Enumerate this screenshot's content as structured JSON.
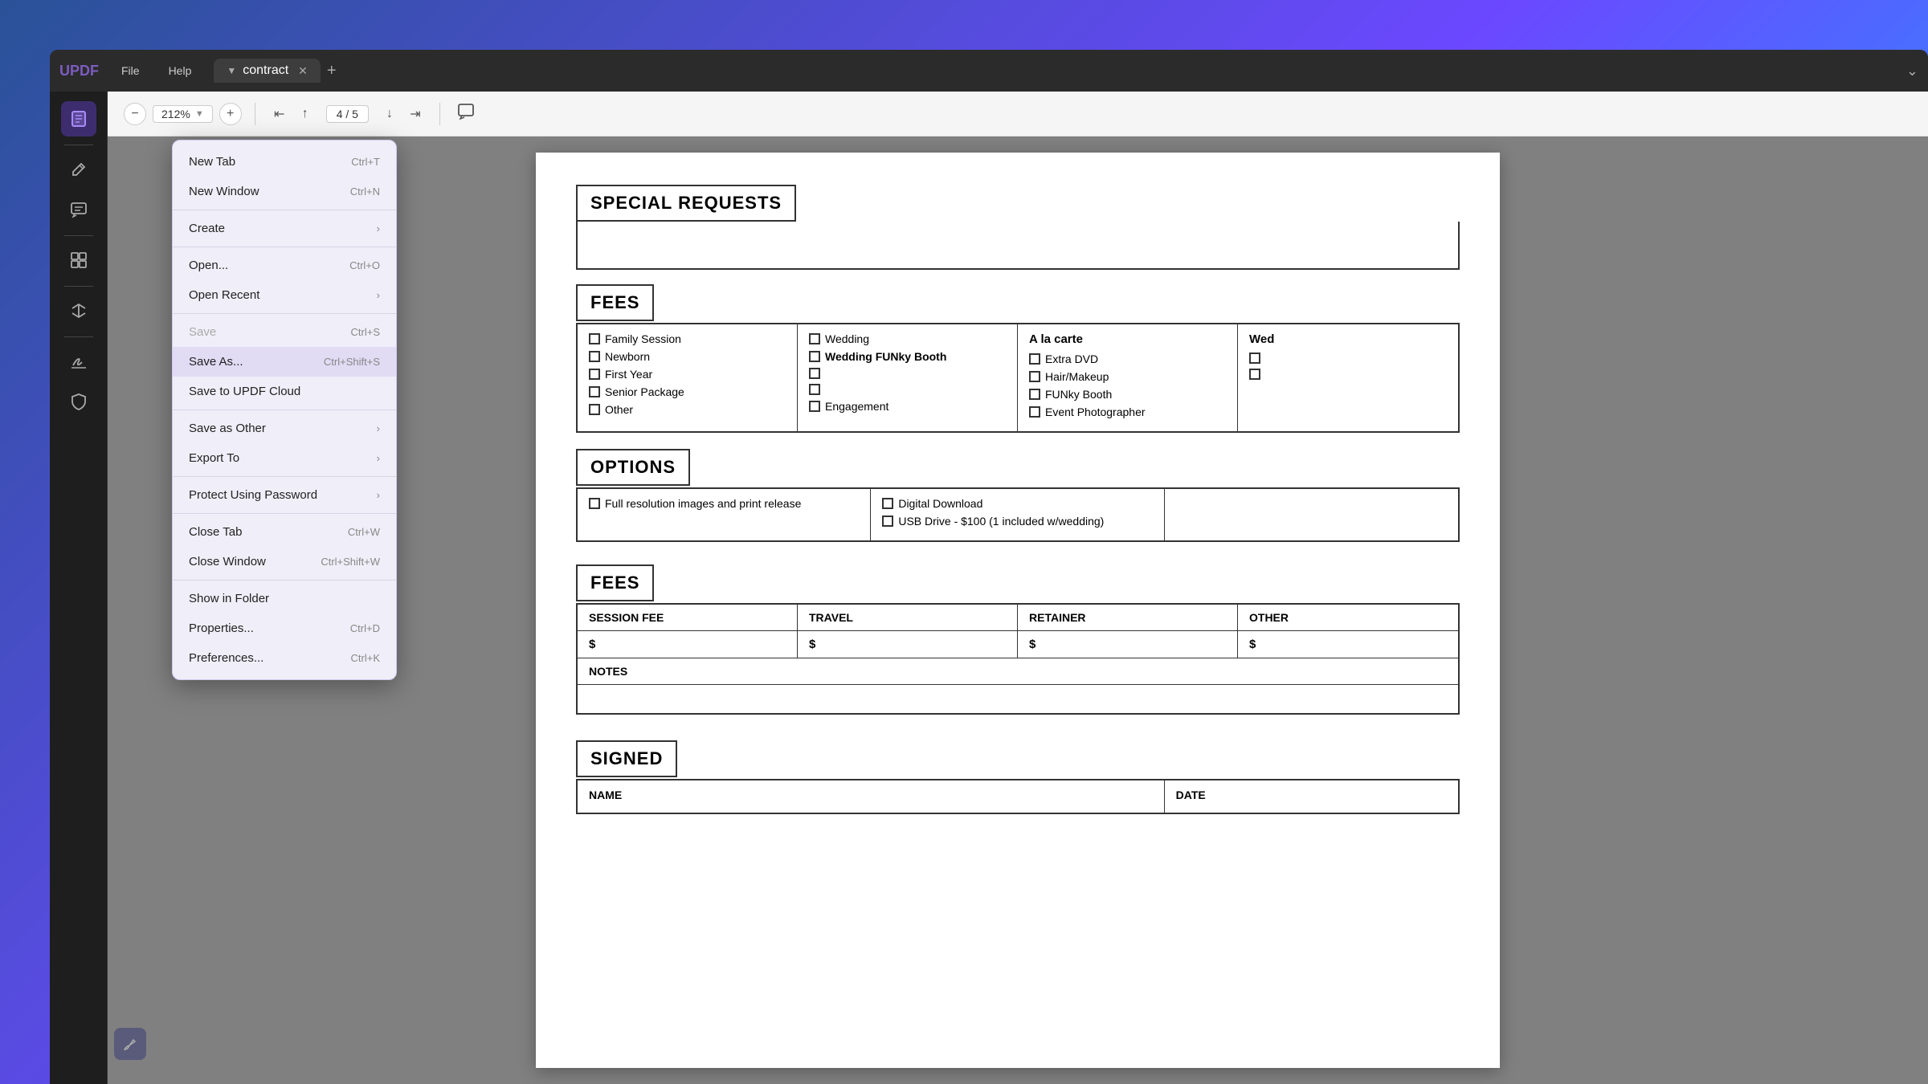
{
  "app": {
    "logo": "UPDF",
    "tab_name": "contract",
    "zoom": "212%",
    "page_current": "4",
    "page_total": "5"
  },
  "toolbar": {
    "zoom_out": "−",
    "zoom_in": "+",
    "nav_first": "⇤",
    "nav_prev": "↑",
    "nav_next": "↓",
    "nav_last": "⇥"
  },
  "menu": {
    "items": [
      {
        "id": "new-tab",
        "label": "New Tab",
        "shortcut": "Ctrl+T",
        "has_arrow": false,
        "disabled": false
      },
      {
        "id": "new-window",
        "label": "New Window",
        "shortcut": "Ctrl+N",
        "has_arrow": false,
        "disabled": false
      },
      {
        "id": "divider1",
        "type": "divider"
      },
      {
        "id": "create",
        "label": "Create",
        "shortcut": "",
        "has_arrow": true,
        "disabled": false
      },
      {
        "id": "divider2",
        "type": "divider"
      },
      {
        "id": "open",
        "label": "Open...",
        "shortcut": "Ctrl+O",
        "has_arrow": false,
        "disabled": false
      },
      {
        "id": "open-recent",
        "label": "Open Recent",
        "shortcut": "",
        "has_arrow": true,
        "disabled": false
      },
      {
        "id": "divider3",
        "type": "divider"
      },
      {
        "id": "save",
        "label": "Save",
        "shortcut": "Ctrl+S",
        "has_arrow": false,
        "disabled": true
      },
      {
        "id": "save-as",
        "label": "Save As...",
        "shortcut": "Ctrl+Shift+S",
        "has_arrow": false,
        "disabled": false,
        "highlighted": true
      },
      {
        "id": "save-to-cloud",
        "label": "Save to UPDF Cloud",
        "shortcut": "",
        "has_arrow": false,
        "disabled": false
      },
      {
        "id": "divider4",
        "type": "divider"
      },
      {
        "id": "save-as-other",
        "label": "Save as Other",
        "shortcut": "",
        "has_arrow": true,
        "disabled": false
      },
      {
        "id": "export-to",
        "label": "Export To",
        "shortcut": "",
        "has_arrow": true,
        "disabled": false
      },
      {
        "id": "divider5",
        "type": "divider"
      },
      {
        "id": "protect-password",
        "label": "Protect Using Password",
        "shortcut": "",
        "has_arrow": true,
        "disabled": false
      },
      {
        "id": "divider6",
        "type": "divider"
      },
      {
        "id": "close-tab",
        "label": "Close Tab",
        "shortcut": "Ctrl+W",
        "has_arrow": false,
        "disabled": false
      },
      {
        "id": "close-window",
        "label": "Close Window",
        "shortcut": "Ctrl+Shift+W",
        "has_arrow": false,
        "disabled": false
      },
      {
        "id": "divider7",
        "type": "divider"
      },
      {
        "id": "show-in-folder",
        "label": "Show in Folder",
        "shortcut": "",
        "has_arrow": false,
        "disabled": false
      },
      {
        "id": "properties",
        "label": "Properties...",
        "shortcut": "Ctrl+D",
        "has_arrow": false,
        "disabled": false
      },
      {
        "id": "preferences",
        "label": "Preferences...",
        "shortcut": "Ctrl+K",
        "has_arrow": false,
        "disabled": false
      }
    ]
  },
  "pdf": {
    "special_requests_label": "SPECIAL REQUESTS",
    "fees_label": "FEES",
    "options_label": "OPTIONS",
    "fees2_label": "FEES",
    "signed_label": "SIGNED",
    "fees_col1": {
      "items": [
        "Family Session",
        "Newborn",
        "First Year",
        "Senior Package",
        "Other"
      ]
    },
    "fees_col2": {
      "items": [
        "Wedding",
        "Wedding - FUNky Booth",
        "",
        "",
        "Engagement"
      ]
    },
    "fees_col3_header": "A la carte",
    "fees_col3": {
      "items": [
        "Extra DVD",
        "Hair/Makeup",
        "FUNky Booth",
        "Event Photographer"
      ]
    },
    "fees_col4_header": "Wed",
    "options_col1": {
      "items": [
        "Full resolution images and print release"
      ]
    },
    "options_col2": {
      "items": [
        "Digital Download",
        "USB Drive - $100 (1 included w/wedding)"
      ]
    },
    "fees_headers": [
      "SESSION FEE",
      "TRAVEL",
      "RETAINER",
      "OTHER"
    ],
    "fees_values": [
      "$",
      "$",
      "$",
      "$"
    ],
    "notes_label": "NOTES",
    "signed_headers": [
      "NAME",
      "DATE"
    ],
    "wedding_funky_booth": "Wedding FUNky Booth",
    "funky_booth": "FUNky Booth"
  },
  "sidebar": {
    "icons": [
      {
        "id": "reader",
        "symbol": "📄",
        "active": true
      },
      {
        "id": "edit",
        "symbol": "✏️",
        "active": false
      },
      {
        "id": "comment",
        "symbol": "💬",
        "active": false
      },
      {
        "id": "organize",
        "symbol": "⊞",
        "active": false
      },
      {
        "id": "convert",
        "symbol": "↔",
        "active": false
      },
      {
        "id": "sign",
        "symbol": "✍",
        "active": false
      },
      {
        "id": "protect",
        "symbol": "🔒",
        "active": false
      }
    ]
  }
}
